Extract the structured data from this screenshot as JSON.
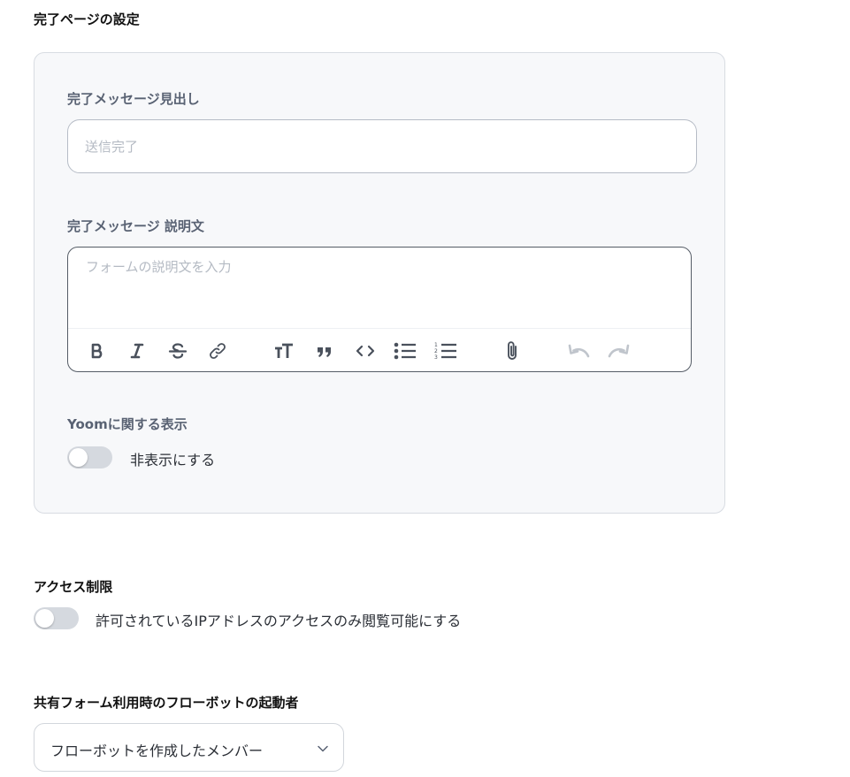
{
  "completion": {
    "title": "完了ページの設定",
    "heading_label": "完了メッセージ見出し",
    "heading_placeholder": "送信完了",
    "description_label": "完了メッセージ 説明文",
    "description_placeholder": "フォームの説明文を入力",
    "toolbar": [
      {
        "name": "bold-icon"
      },
      {
        "name": "italic-icon"
      },
      {
        "name": "strikethrough-icon"
      },
      {
        "name": "link-icon"
      },
      {
        "name": "text-size-icon"
      },
      {
        "name": "quote-icon"
      },
      {
        "name": "code-icon"
      },
      {
        "name": "bullet-list-icon"
      },
      {
        "name": "numbered-list-icon"
      },
      {
        "name": "attachment-icon"
      },
      {
        "name": "undo-icon"
      },
      {
        "name": "redo-icon"
      }
    ],
    "yoom_label": "Yoomに関する表示",
    "yoom_toggle_label": "非表示にする",
    "yoom_toggle_on": false
  },
  "access": {
    "title": "アクセス制限",
    "toggle_label": "許可されているIPアドレスのアクセスのみ閲覧可能にする",
    "toggle_on": false
  },
  "shared_form": {
    "title": "共有フォーム利用時のフローボットの起動者",
    "selected": "フローボットを作成したメンバー"
  },
  "colors": {
    "panel_bg": "#f7f8fa",
    "label": "#596273",
    "placeholder": "#b4bac3",
    "toggle_off": "#d5d9df"
  }
}
